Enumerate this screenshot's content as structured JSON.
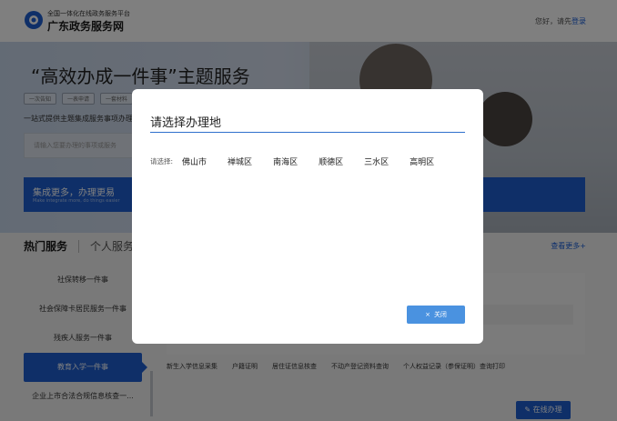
{
  "header": {
    "site_subtitle": "全国一体化在线政务服务平台",
    "site_title": "广东政务服务网",
    "greeting": "您好，请先",
    "login": "登录"
  },
  "hero": {
    "title": "“高效办成一件事”主题服务",
    "tags": [
      "一次告知",
      "一表申请",
      "一套材料"
    ],
    "description": "一站式提供主题集成服务事项办理",
    "search_placeholder": "请输入您要办理的事项或服务"
  },
  "banner": {
    "title": "集成更多，办理更易",
    "subtitle": "Make integrate more, do things easier"
  },
  "services": {
    "tab_hot": "热门服务",
    "tab_personal": "个人服务",
    "more": "查看更多+",
    "side_items": [
      "社保转移一件事",
      "社会保障卡居民服务一件事",
      "残疾人服务一件事",
      "教育入学一件事",
      "企业上市合法合规信息核查一..."
    ],
    "active_index": 3,
    "links": [
      "新生入学信息采集",
      "户籍证明",
      "居住证信息核查",
      "不动产登记资料查询",
      "个人权益记录（参保证明）查询打印"
    ],
    "online_button": "在线办理"
  },
  "modal": {
    "title": "请选择办理地",
    "region_label": "请选择:",
    "regions": [
      "佛山市",
      "禅城区",
      "南海区",
      "顺德区",
      "三水区",
      "高明区"
    ],
    "close_label": "关闭",
    "close_icon": "close-icon"
  },
  "colors": {
    "brand_blue": "#1e5fd1",
    "modal_button": "#4a92e0",
    "rule_blue": "#2e6fcc"
  }
}
